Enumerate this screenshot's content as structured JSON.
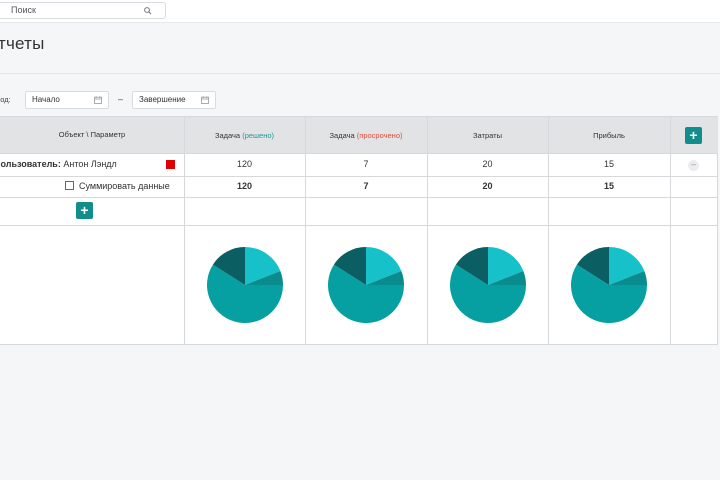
{
  "search": {
    "placeholder": "Поиск",
    "icon": "search-icon"
  },
  "page": {
    "title": "тчеты"
  },
  "period": {
    "label": "иод:",
    "start_value": "Начало",
    "end_value": "Завершение",
    "separator": "–"
  },
  "table": {
    "header": {
      "object_param": "Объект \\ Параметр",
      "columns": [
        {
          "base": "Задача",
          "paren": "(решено)"
        },
        {
          "base": "Задача",
          "paren": "(просрочено)"
        },
        {
          "base": "Затраты",
          "paren": ""
        },
        {
          "base": "Прибыль",
          "paren": ""
        }
      ],
      "add_label": "+"
    },
    "user_row": {
      "prefix": "Пользователь:",
      "name": "Антон Лэндл",
      "color": "#e00000",
      "values": [
        "120",
        "7",
        "20",
        "15"
      ],
      "remove_label": "–"
    },
    "sum_row": {
      "checkbox_label": "Суммировать данные",
      "checked": false,
      "values": [
        "120",
        "7",
        "20",
        "15"
      ]
    },
    "add_object_label": "+"
  },
  "colors": {
    "accent": "#118e8c",
    "solved": "#1a9a98",
    "overdue": "#e24b3b"
  },
  "chart_data": {
    "type": "pie",
    "colors": [
      "#16c1c9",
      "#0a8c8e",
      "#06a0a3",
      "#0b5e62"
    ],
    "charts": [
      {
        "values": [
          19,
          6,
          59,
          16
        ]
      },
      {
        "values": [
          19,
          6,
          59,
          16
        ]
      },
      {
        "values": [
          19,
          6,
          59,
          16
        ]
      },
      {
        "values": [
          19,
          6,
          59,
          16
        ]
      }
    ]
  }
}
